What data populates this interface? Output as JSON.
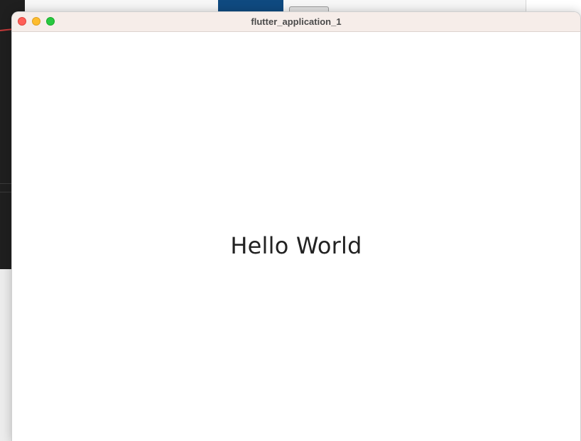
{
  "window": {
    "title": "flutter_application_1"
  },
  "content": {
    "text": "Hello World"
  },
  "colors": {
    "titlebar": "#f6ede9",
    "close": "#ff5f57",
    "minimize": "#febc2e",
    "maximize": "#28c840"
  },
  "icons": {
    "close": "close-icon",
    "minimize": "minimize-icon",
    "maximize": "maximize-icon"
  }
}
